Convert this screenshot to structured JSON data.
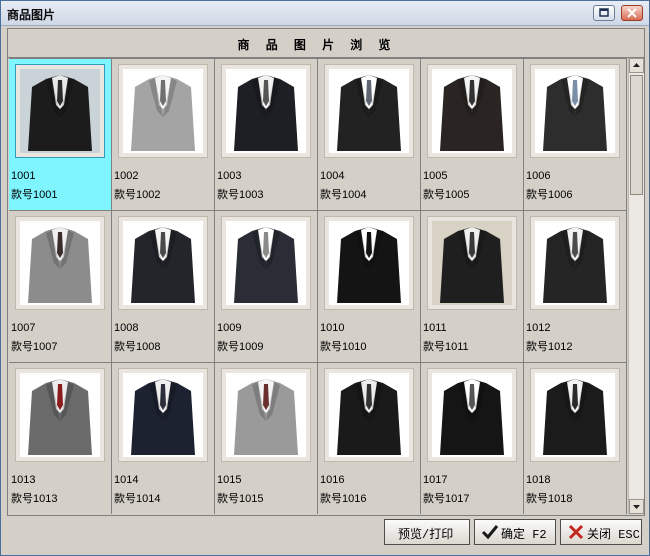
{
  "window": {
    "title": "商品图片"
  },
  "header": {
    "title": "商 品 图 片 浏 览"
  },
  "products": [
    {
      "code": "1001",
      "style": "款号1001",
      "color": "#1c1c1c",
      "shirt": "#e8e8e8",
      "tie": "#2a2a2a",
      "bg": "#c9d3d8",
      "selected": true
    },
    {
      "code": "1002",
      "style": "款号1002",
      "color": "#a4a4a4",
      "shirt": "#f4f4f4",
      "tie": "#6f6f6f",
      "bg": "#ffffff",
      "selected": false
    },
    {
      "code": "1003",
      "style": "款号1003",
      "color": "#1e1f24",
      "shirt": "#f2f2f2",
      "tie": "#555555",
      "bg": "#ffffff",
      "selected": false
    },
    {
      "code": "1004",
      "style": "款号1004",
      "color": "#222222",
      "shirt": "#ffffff",
      "tie": "#5e6670",
      "bg": "#ffffff",
      "selected": false
    },
    {
      "code": "1005",
      "style": "款号1005",
      "color": "#2a2523",
      "shirt": "#f5f5f5",
      "tie": "#333333",
      "bg": "#ffffff",
      "selected": false
    },
    {
      "code": "1006",
      "style": "款号1006",
      "color": "#2d2d2d",
      "shirt": "#ffffff",
      "tie": "#7a8fa8",
      "bg": "#ffffff",
      "selected": false
    },
    {
      "code": "1007",
      "style": "款号1007",
      "color": "#8c8c8c",
      "shirt": "#f0f0f0",
      "tie": "#3b2c2c",
      "bg": "#ffffff",
      "selected": false
    },
    {
      "code": "1008",
      "style": "款号1008",
      "color": "#23252b",
      "shirt": "#f6f6f6",
      "tie": "#4a4a4a",
      "bg": "#ffffff",
      "selected": false
    },
    {
      "code": "1009",
      "style": "款号1009",
      "color": "#2a2d36",
      "shirt": "#ffffff",
      "tie": "#8a8a8a",
      "bg": "#ffffff",
      "selected": false
    },
    {
      "code": "1010",
      "style": "款号1010",
      "color": "#141414",
      "shirt": "#ffffff",
      "tie": "#111111",
      "bg": "#ffffff",
      "selected": false
    },
    {
      "code": "1011",
      "style": "款号1011",
      "color": "#1f1f1f",
      "shirt": "#efefef",
      "tie": "#3a3a3a",
      "bg": "#d8d2c4",
      "selected": false
    },
    {
      "code": "1012",
      "style": "款号1012",
      "color": "#252525",
      "shirt": "#f2f2f2",
      "tie": "#4b4b4b",
      "bg": "#ffffff",
      "selected": false
    },
    {
      "code": "1013",
      "style": "款号1013",
      "color": "#6b6b6b",
      "shirt": "#ededed",
      "tie": "#8a1c1c",
      "bg": "#ffffff",
      "selected": false
    },
    {
      "code": "1014",
      "style": "款号1014",
      "color": "#1d2230",
      "shirt": "#f0f0f0",
      "tie": "#2b2f3b",
      "bg": "#ffffff",
      "selected": false
    },
    {
      "code": "1015",
      "style": "款号1015",
      "color": "#9a9a9a",
      "shirt": "#f5f5f5",
      "tie": "#6b3030",
      "bg": "#ffffff",
      "selected": false
    },
    {
      "code": "1016",
      "style": "款号1016",
      "color": "#1a1a1a",
      "shirt": "#eeeeee",
      "tie": "#333333",
      "bg": "#ffffff",
      "selected": false
    },
    {
      "code": "1017",
      "style": "款号1017",
      "color": "#151515",
      "shirt": "#ffffff",
      "tie": "#555555",
      "bg": "#ffffff",
      "selected": false
    },
    {
      "code": "1018",
      "style": "款号1018",
      "color": "#1b1b1b",
      "shirt": "#f3f3f3",
      "tie": "#2a2a2a",
      "bg": "#ffffff",
      "selected": false
    }
  ],
  "buttons": {
    "print_label": "预览/打印",
    "ok_label": "确定 F2",
    "close_label": "关闭 ESC"
  },
  "colors": {
    "selection": "#7ff6ff",
    "ok_check": "#1a1a1a",
    "close_x": "#c0281e"
  }
}
